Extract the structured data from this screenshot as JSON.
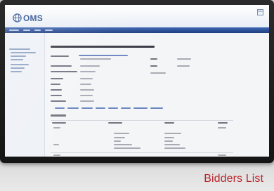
{
  "app": {
    "name": "OMS",
    "logo_icon": "globe-icon",
    "accent_color": "#2a4f8f",
    "nav_color": "#2b4f96"
  },
  "caption": {
    "text": "Bidders List",
    "color": "#b9262c"
  }
}
